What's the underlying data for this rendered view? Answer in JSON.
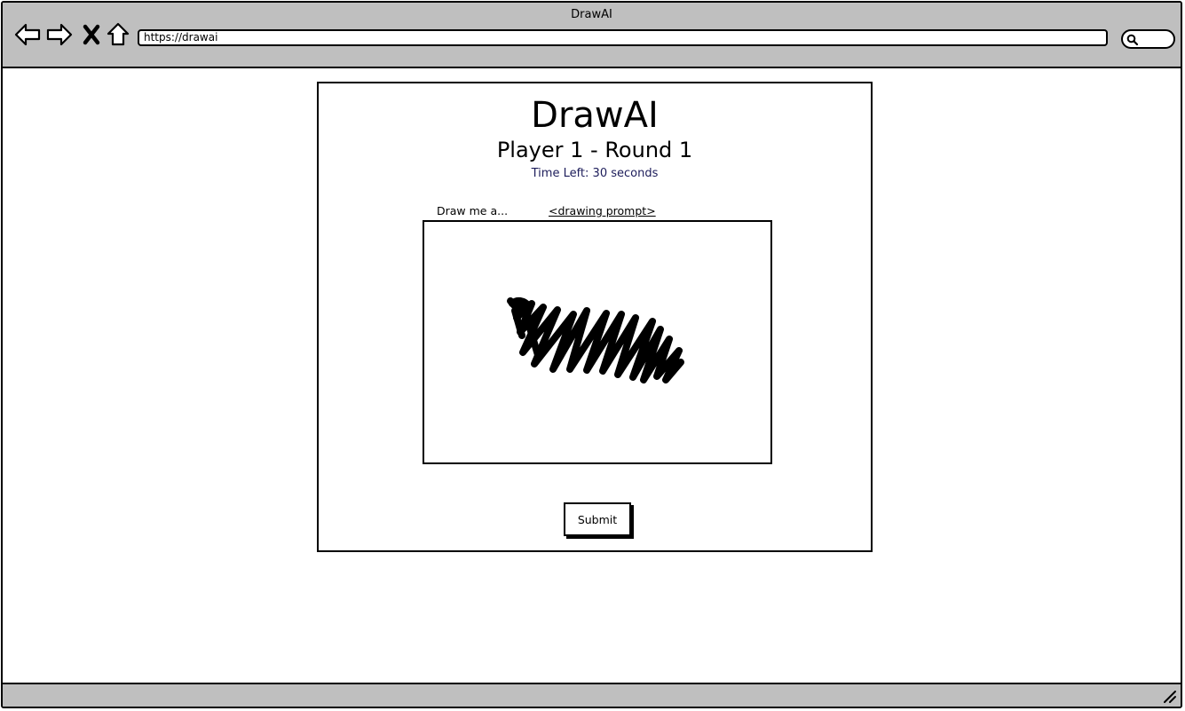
{
  "window": {
    "title": "DrawAI",
    "url": "https://drawai"
  },
  "toolbar": {
    "icons": [
      "back-arrow-icon",
      "forward-arrow-icon",
      "close-x-icon",
      "home-icon",
      "search-icon",
      "resize-grip-icon"
    ]
  },
  "page": {
    "app_title": "DrawAI",
    "round_title": "Player 1 - Round 1",
    "timer_text": "Time Left: 30 seconds",
    "prompt_label": "Draw me a...",
    "prompt_placeholder": "<drawing prompt>",
    "submit_label": "Submit"
  },
  "colors": {
    "chrome": "#bfbfbf",
    "timer_text": "#1c1c5a",
    "ink": "#000000"
  }
}
